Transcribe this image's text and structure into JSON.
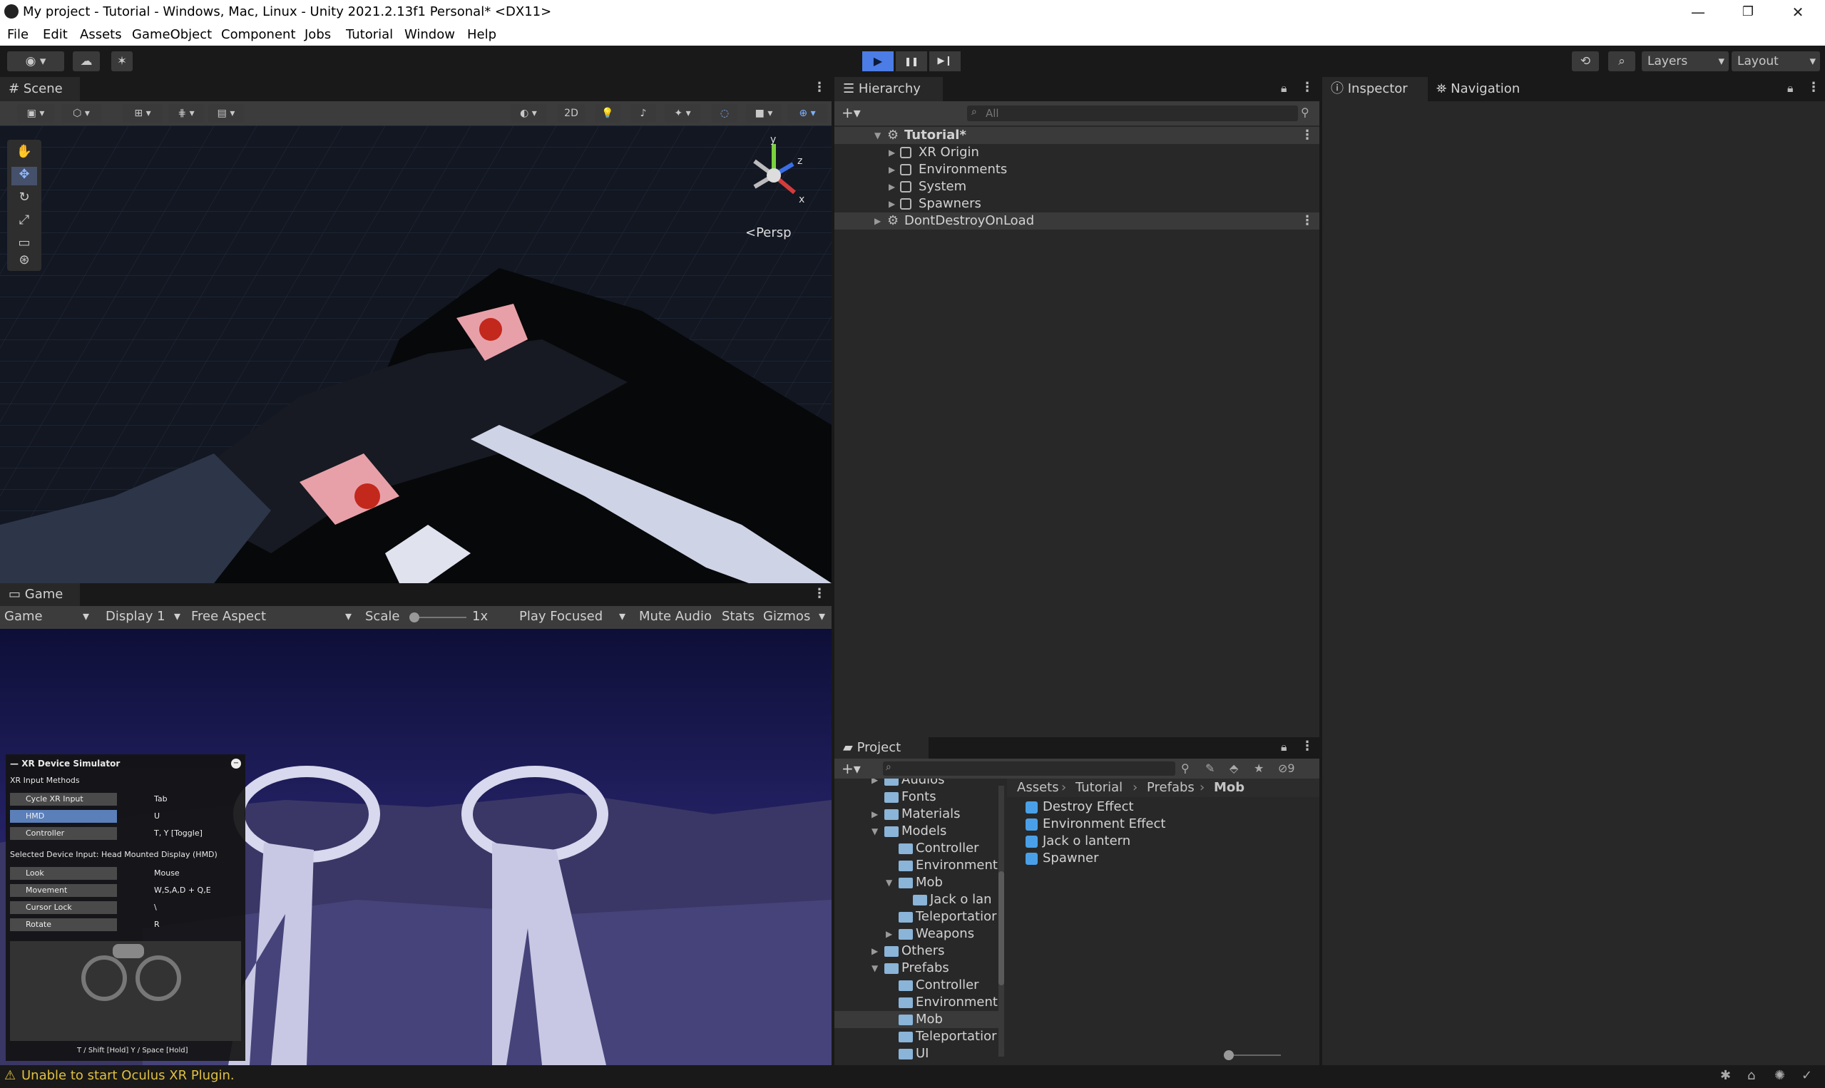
{
  "window": {
    "title": "My project - Tutorial - Windows, Mac, Linux - Unity 2021.2.13f1 Personal* <DX11>",
    "minimize": "—",
    "maximize": "❐",
    "close": "✕"
  },
  "menu": [
    "File",
    "Edit",
    "Assets",
    "GameObject",
    "Component",
    "Jobs",
    "Tutorial",
    "Window",
    "Help"
  ],
  "toolbar": {
    "layers_label": "Layers",
    "layout_label": "Layout",
    "play": "▶",
    "pause": "❚❚",
    "step": "▶❙"
  },
  "scene": {
    "tab_label": "Scene",
    "mode_2d": "2D",
    "persp_label": "<Persp",
    "gizmo_axes": {
      "x": "x",
      "y": "y",
      "z": "z"
    }
  },
  "game": {
    "tab_label": "Game",
    "view_select": "Game",
    "display_select": "Display 1",
    "aspect_select": "Free Aspect",
    "scale_label": "Scale",
    "scale_value": "1x",
    "play_focused": "Play Focused",
    "mute_audio": "Mute Audio",
    "stats": "Stats",
    "gizmos": "Gizmos"
  },
  "xr_sim": {
    "title": "XR Device Simulator",
    "input_methods_label": "XR Input Methods",
    "methods": [
      {
        "label": "Cycle XR Input",
        "key": "Tab"
      },
      {
        "label": "HMD",
        "key": "U"
      },
      {
        "label": "Controller",
        "key": "T, Y [Toggle]"
      }
    ],
    "selected_label": "Selected Device Input:  Head Mounted Display (HMD)",
    "inputs": [
      {
        "label": "Look",
        "key": "Mouse"
      },
      {
        "label": "Movement",
        "key": "W,S,A,D + Q,E"
      },
      {
        "label": "Cursor Lock",
        "key": "\\"
      },
      {
        "label": "Rotate",
        "key": "R"
      }
    ],
    "footer": "T / Shift [Hold]   Y / Space [Hold]"
  },
  "hierarchy": {
    "tab_label": "Hierarchy",
    "search_placeholder": "All",
    "items": [
      {
        "label": "Tutorial*",
        "level": 0,
        "type": "scene"
      },
      {
        "label": "XR Origin",
        "level": 1,
        "type": "object"
      },
      {
        "label": "Environments",
        "level": 1,
        "type": "object"
      },
      {
        "label": "System",
        "level": 1,
        "type": "object"
      },
      {
        "label": "Spawners",
        "level": 1,
        "type": "object"
      },
      {
        "label": "DontDestroyOnLoad",
        "level": 0,
        "type": "scene"
      }
    ]
  },
  "inspector": {
    "tab_label": "Inspector",
    "nav_tab_label": "Navigation"
  },
  "project": {
    "tab_label": "Project",
    "hidden_count": "9",
    "tree": [
      {
        "label": "Audios",
        "level": 1
      },
      {
        "label": "Fonts",
        "level": 1
      },
      {
        "label": "Materials",
        "level": 1
      },
      {
        "label": "Models",
        "level": 1
      },
      {
        "label": "Controller",
        "level": 2
      },
      {
        "label": "Environment",
        "level": 2
      },
      {
        "label": "Mob",
        "level": 2
      },
      {
        "label": "Jack o lan",
        "level": 3
      },
      {
        "label": "Teleportatior",
        "level": 2
      },
      {
        "label": "Weapons",
        "level": 2
      },
      {
        "label": "Others",
        "level": 1
      },
      {
        "label": "Prefabs",
        "level": 1
      },
      {
        "label": "Controller",
        "level": 2
      },
      {
        "label": "Environment",
        "level": 2
      },
      {
        "label": "Mob",
        "level": 2
      },
      {
        "label": "Teleportatior",
        "level": 2
      },
      {
        "label": "UI",
        "level": 2
      }
    ],
    "breadcrumb": [
      "Assets",
      "Tutorial",
      "Prefabs",
      "Mob"
    ],
    "assets": [
      "Destroy Effect",
      "Environment Effect",
      "Jack o lantern",
      "Spawner"
    ]
  },
  "status": {
    "message": "Unable to start Oculus XR Plugin."
  },
  "colors": {
    "accent": "#4c7ce6",
    "panel": "#282828",
    "warning": "#e0c040"
  }
}
